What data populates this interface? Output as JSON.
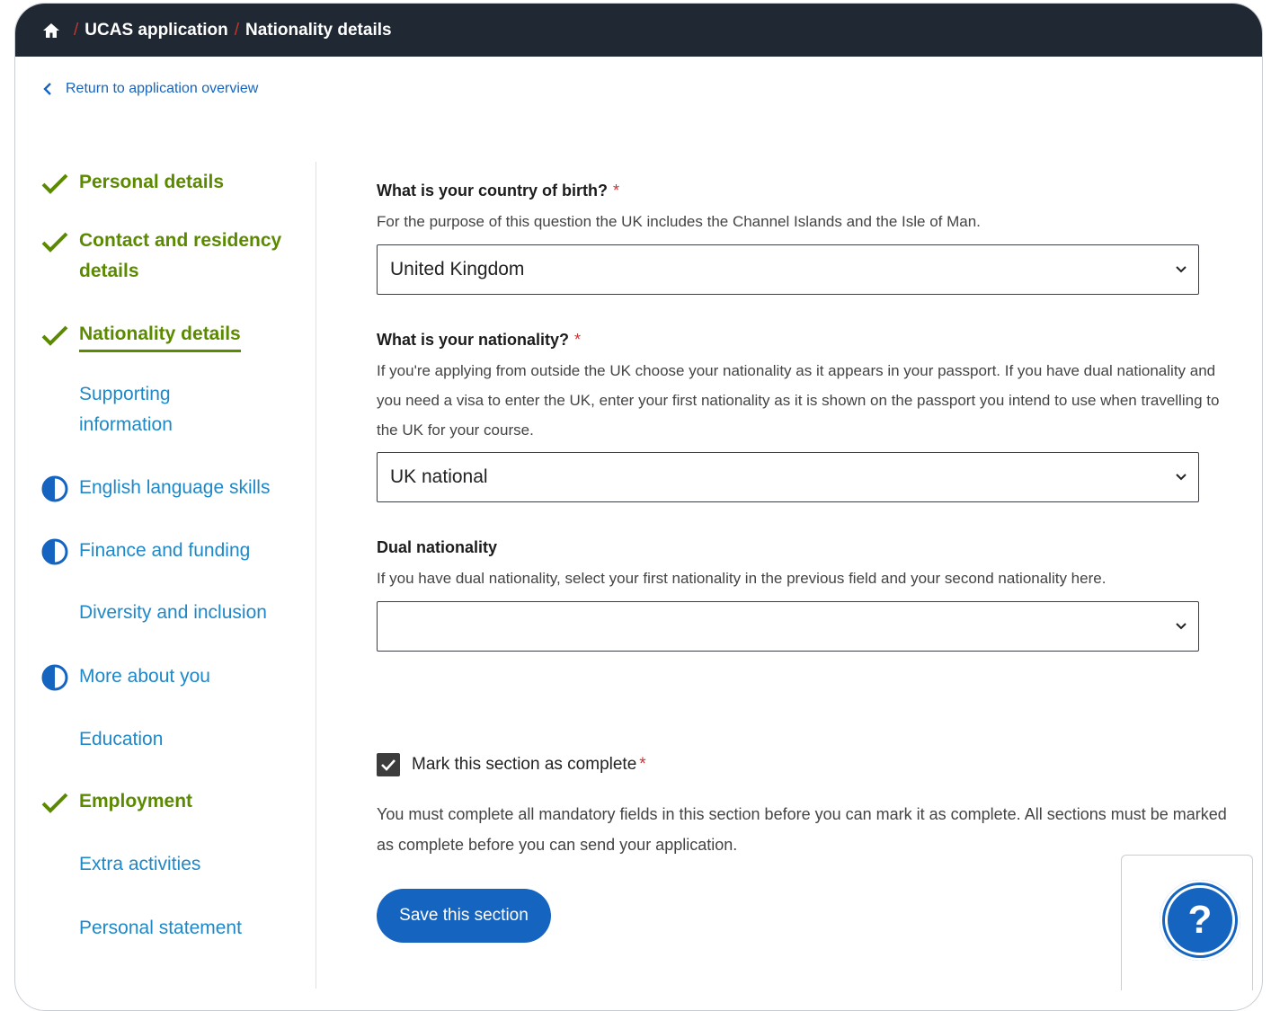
{
  "breadcrumb": {
    "home_icon": "home-icon",
    "separator": "/",
    "items": [
      "UCAS application",
      "Nationality details"
    ]
  },
  "back_link": {
    "label": "Return to application overview",
    "icon": "chevron-left-icon"
  },
  "sidebar": {
    "items": [
      {
        "label": "Personal details",
        "status": "complete"
      },
      {
        "label": "Contact and residency details",
        "status": "complete"
      },
      {
        "label": "Nationality details",
        "status": "complete-current"
      },
      {
        "label": "Supporting information",
        "status": "none"
      },
      {
        "label": "English language skills",
        "status": "in-progress"
      },
      {
        "label": "Finance and funding",
        "status": "in-progress"
      },
      {
        "label": "Diversity and inclusion",
        "status": "none"
      },
      {
        "label": "More about you",
        "status": "in-progress"
      },
      {
        "label": "Education",
        "status": "none"
      },
      {
        "label": "Employment",
        "status": "complete"
      },
      {
        "label": "Extra activities",
        "status": "none"
      },
      {
        "label": "Personal statement",
        "status": "none"
      }
    ]
  },
  "form": {
    "birth": {
      "label": "What is your country of birth?",
      "required_mark": "*",
      "hint": "For the purpose of this question the UK includes the Channel Islands and the Isle of Man.",
      "value": "United Kingdom"
    },
    "nationality": {
      "label": "What is your nationality?",
      "required_mark": "*",
      "hint": "If you're applying from outside the UK choose your nationality as it appears in your passport. If you have dual nationality and you need a visa to enter the UK, enter your first nationality as it is shown on the passport you intend to use when travelling to the UK for your course.",
      "value": "UK national"
    },
    "dual": {
      "label": "Dual nationality",
      "hint": "If you have dual nationality, select your first nationality in the previous field and your second nationality here.",
      "value": ""
    },
    "complete": {
      "label": "Mark this section as complete",
      "required_mark": "*",
      "checked": true,
      "note": "You must complete all mandatory fields in this section before you can mark it as complete. All sections must be marked as complete before you can send your application."
    },
    "save_label": "Save this section"
  },
  "help": {
    "label": "?",
    "icon": "help-icon"
  },
  "colors": {
    "topbar": "#202833",
    "complete_green": "#5b8a00",
    "link_blue": "#1e88c8",
    "primary_blue": "#1565c0",
    "required_red": "#d32f2f"
  }
}
